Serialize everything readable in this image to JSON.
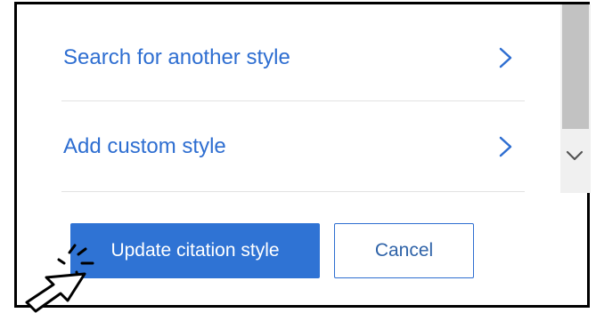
{
  "menu": {
    "items": [
      {
        "label": "Search for another style",
        "icon": "chevron-right-icon"
      },
      {
        "label": "Add custom style",
        "icon": "chevron-right-icon"
      }
    ]
  },
  "actions": {
    "update_label": "Update citation style",
    "cancel_label": "Cancel"
  },
  "scrollbar": {
    "arrow_icon": "chevron-down-icon"
  },
  "colors": {
    "link": "#2e6ed1",
    "primary_button": "#2f73d4",
    "divider": "#e2e2e2"
  }
}
